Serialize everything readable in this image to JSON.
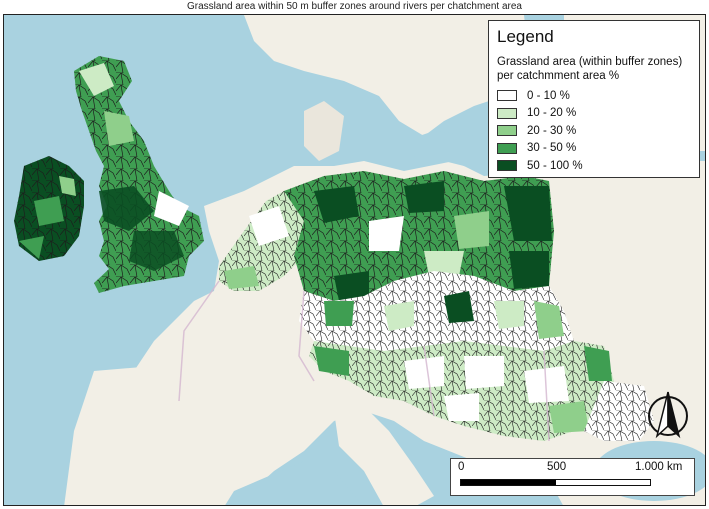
{
  "title": "Grassland area within 50 m buffer zones around rivers per chatchment area",
  "legend": {
    "title": "Legend",
    "subtitle": "Grassland area (within buffer zones)\nper catchmment area %",
    "classes": [
      {
        "label": "0 - 10 %",
        "color": "#ffffff"
      },
      {
        "label": "10 - 20 %",
        "color": "#cdebc5"
      },
      {
        "label": "20 - 30 %",
        "color": "#8fcf8b"
      },
      {
        "label": "30 - 50 %",
        "color": "#3f9e52"
      },
      {
        "label": "50 - 100 %",
        "color": "#0a4e22"
      }
    ]
  },
  "scalebar": {
    "labels": [
      "0",
      "500",
      "1.000 km"
    ],
    "max_value": 1000
  },
  "north_arrow": {
    "icon": "north-arrow-icon"
  },
  "basemap": {
    "sea_color": "#a9d2e0",
    "land_color": "#f2efe6",
    "border_color": "#d3b7cf",
    "catchment_stroke": "#1c1c1c"
  }
}
